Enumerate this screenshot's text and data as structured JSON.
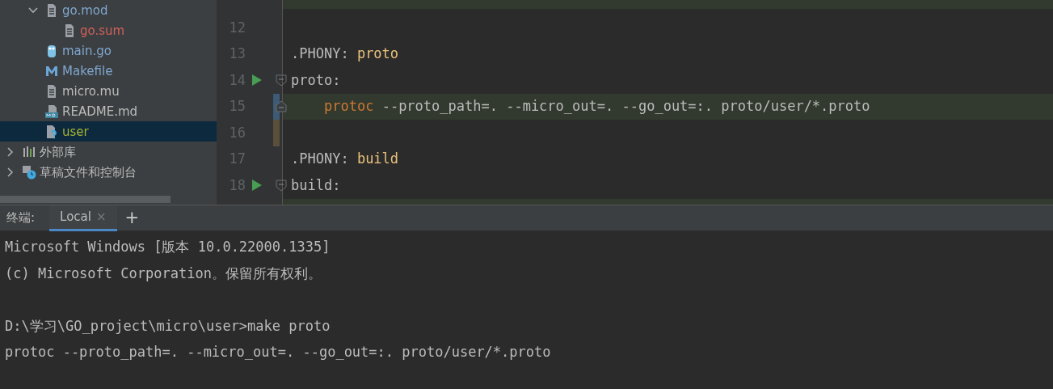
{
  "project_tree": {
    "files": [
      {
        "label": "go.mod",
        "kind": "file",
        "color": "#7fa7cf",
        "expanded": true,
        "selected": false,
        "children": [
          {
            "label": "go.sum",
            "kind": "file",
            "color": "#d0605a",
            "selected": false
          }
        ]
      },
      {
        "label": "main.go",
        "kind": "gopher",
        "color": "#7fa7cf",
        "selected": false
      },
      {
        "label": "Makefile",
        "kind": "makefile",
        "color": "#7fa7cf",
        "selected": false
      },
      {
        "label": "micro.mu",
        "kind": "file",
        "color": "#bbbbbb",
        "selected": false
      },
      {
        "label": "README.md",
        "kind": "markdown",
        "color": "#bbbbbb",
        "selected": false
      },
      {
        "label": "user",
        "kind": "unknown",
        "color": "#a5b236",
        "selected": true
      }
    ],
    "roots": [
      {
        "label": "外部库",
        "kind": "library",
        "expanded": false
      },
      {
        "label": "草稿文件和控制台",
        "kind": "scratch",
        "expanded": false
      }
    ]
  },
  "editor": {
    "lines": [
      {
        "number": "12"
      },
      {
        "number": "13",
        "tokens": [
          {
            "kind": "plain",
            "text": ".PHONY: "
          },
          {
            "kind": "target",
            "text": "proto"
          }
        ]
      },
      {
        "number": "14",
        "run": true,
        "fold_start": true,
        "tokens": [
          {
            "kind": "plain",
            "text": "proto:"
          }
        ]
      },
      {
        "number": "15",
        "fold_end": true,
        "highlighted": true,
        "modified": true,
        "indent": true,
        "tokens": [
          {
            "kind": "command",
            "text": "protoc"
          },
          {
            "kind": "plain",
            "text": " --proto_path=. --micro_out=. --go_out=:. proto/user/*.proto"
          }
        ]
      },
      {
        "number": "16",
        "added": true
      },
      {
        "number": "17",
        "tokens": [
          {
            "kind": "plain",
            "text": ".PHONY: "
          },
          {
            "kind": "target",
            "text": "build"
          }
        ]
      },
      {
        "number": "18",
        "run": true,
        "fold_start": true,
        "tokens": [
          {
            "kind": "plain",
            "text": "build:"
          }
        ]
      }
    ]
  },
  "terminal": {
    "title": "终端:",
    "tabs": [
      {
        "label": "Local",
        "close": "×",
        "selected": true
      }
    ],
    "add_button": "+",
    "output": [
      {
        "text": "Microsoft Windows [版本 10.0.22000.1335]"
      },
      {
        "text": "(c) Microsoft Corporation。保留所有权利。"
      },
      {
        "text": "D:\\学习\\GO_project\\micro\\user>make proto",
        "blank_before": true
      },
      {
        "text": "protoc --proto_path=. --micro_out=. --go_out=:. proto/user/*.proto"
      }
    ]
  }
}
